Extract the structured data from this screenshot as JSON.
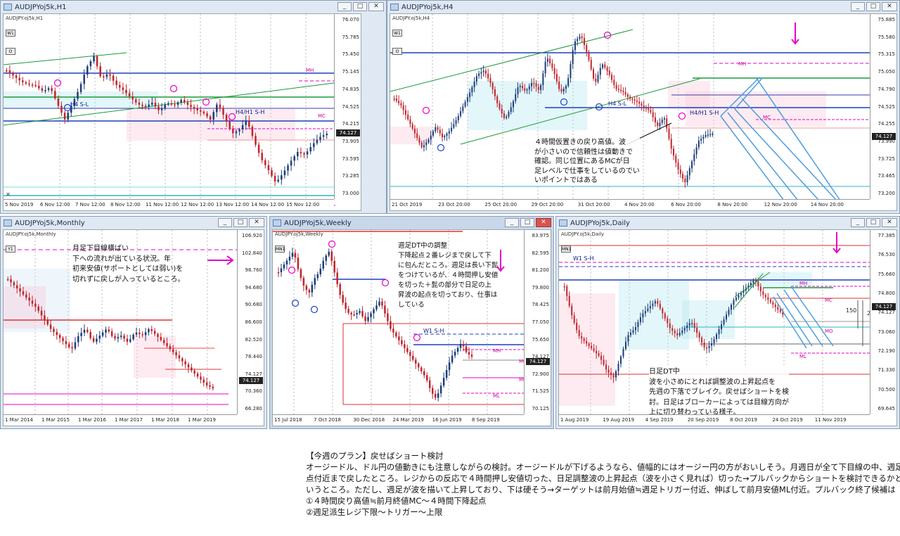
{
  "windows": {
    "h1": {
      "title": "AUDJPYoj5k,H1",
      "symbol": "AUDJPY.oj5k,H1",
      "timeframe": "W1",
      "yticks": [
        "76.070",
        "75.785",
        "75.450",
        "75.145",
        "74.835",
        "74.525",
        "74.215",
        "73.905",
        "73.595",
        "73.285",
        "73.000"
      ],
      "xticks": [
        "5 Nov 2019",
        "6 Nov 12:00",
        "7 Nov 12:00",
        "8 Nov 12:00",
        "11 Nov 12:00",
        "12 Nov 12:00",
        "13 Nov 12:00",
        "14 Nov 12:00",
        "15 Nov 12:00"
      ],
      "price": "74.127",
      "labels": {
        "s_l": "H4 S-L",
        "s_h": "H4/H1 S-H",
        "mh": "MH",
        "mc": "MC",
        "mo": "MO"
      }
    },
    "h4": {
      "title": "AUDJPYoj5k,H4",
      "symbol": "AUDJPY.oj5k,H4",
      "timeframe": "W1",
      "yticks": [
        "75.885",
        "75.580",
        "75.315",
        "75.050",
        "74.790",
        "74.525",
        "74.255",
        "73.990",
        "73.725",
        "73.465",
        "73.200"
      ],
      "xticks": [
        "21 Oct 2019",
        "23 Oct 20:00",
        "25 Oct 20:00",
        "29 Oct 20:00",
        "31 Oct 20:00",
        "4 Nov 20:00",
        "6 Nov 20:00",
        "8 Nov 20:00",
        "12 Nov 20:00",
        "14 Nov 20:00"
      ],
      "price": "74.127",
      "labels": {
        "s_l": "H4 S-L",
        "s_h": "H4/H1 S-H",
        "mh": "MH",
        "mc": "MC"
      },
      "note": "４時間仮置きの戻り高値。波\nが小さいので信頼性は値動きで\n確認。同じ位置にあるMCが日\n足レベルで仕事をしているのでい\nいポイントではある"
    },
    "monthly": {
      "title": "AUDJPYoj5k,Monthly",
      "symbol": "AUDJPY.oj5k,Monthly",
      "timeframe": "Y1",
      "yticks": [
        "106.920",
        "102.840",
        "98.760",
        "94.680",
        "90.680",
        "86.600",
        "82.520",
        "78.440",
        "74.127",
        "70.360",
        "66.280"
      ],
      "xticks": [
        "1 Mar 2014",
        "1 Mar 2015",
        "1 Mar 2016",
        "1 Mar 2017",
        "1 Mar 2018",
        "1 Mar 2019"
      ],
      "price": "74.127",
      "note": "月足下目線横ばい\n下への流れが出ている状況。年\n初来安値(サポートとしては弱い)を\n切れずに戻しが入っているところ。"
    },
    "weekly": {
      "title": "AUDJPYoj5k,Weekly",
      "symbol": "AUDJPY.oj5k,Weekly",
      "timeframe": "MN1",
      "yticks": [
        "83.975",
        "82.595",
        "81.200",
        "79.800",
        "78.425",
        "77.050",
        "75.650",
        "74.127",
        "72.900",
        "71.525",
        "70.125"
      ],
      "xticks": [
        "15 Jul 2018",
        "7 Oct 2018",
        "30 Dec 2018",
        "24 Mar 2019",
        "16 Jun 2019",
        "8 Sep 2019"
      ],
      "price": "74.127",
      "labels": {
        "s_h": "W1 S-H",
        "mh": "MH",
        "mc": "MC",
        "mo": "MO",
        "ml": "ML"
      },
      "note": "週足DT中の調整\n下降起点２番レジまで戻して下\nに包んだところ。週足は長い下髭\nをつけているが、４時間押し安値\nを切った＋髭の部分で日足の上\n昇波の起点を切っており、仕事は\nしている"
    },
    "daily": {
      "title": "AUDJPYoj5k,Daily",
      "symbol": "AUDJPY.oj5k,Daily",
      "timeframe": "MN1",
      "yticks": [
        "77.385",
        "76.530",
        "75.660",
        "74.800",
        "74.127",
        "73.060",
        "72.190",
        "71.330",
        "70.500",
        "69.645"
      ],
      "xticks": [
        "1 Aug 2019",
        "19 Aug 2019",
        "4 Sep 2019",
        "20 Sep 2019",
        "8 Oct 2019",
        "24 Oct 2019",
        "11 Nov 2019"
      ],
      "price": "74.127",
      "labels": {
        "s_h": "W1 S-H",
        "mh": "MH",
        "mc": "MC",
        "mo": "MO",
        "ml": "ML",
        "d150": "150",
        "d250": "250"
      },
      "note": "日足DT中\n波を小さめにとれば調整波の上昇起点を\n先週の下落でブレイク。戻せばショートを検\n討。日足はブローカーによっては目線方向が\n上に切り替わっている様子。"
    }
  },
  "plan": {
    "heading": "【今週のプラン】戻せばショート検討",
    "lines": [
      "オージードル、ドル円の値動きにも注意しながらの検討。オージードルが下げるようなら、値幅的にはオージー円の方がおいしそう。月週日が全て下目線の中、週足下降起",
      "点付近まで戻したところ。レジからの反応で４時間押し安値切った、日足調整波の上昇起点（波を小さく見れば）切った→プルバックからショートを検討できるかと",
      "いうところ。ただし、週足が波を描いて上昇しており、下は硬そう→ターゲットは前月始値≒週足トリガー付近、伸ばして前月安値ML付近。プルバック終了候補は",
      "①４時間戻り高値≒前月終値MC〜４時間下降起点",
      "②週足派生レジ下限〜トリガー〜上限"
    ]
  },
  "colors": {
    "bull": "#1c3d7a",
    "bear": "#c0242b",
    "magenta": "#e800c8",
    "blue": "#1f3fbf",
    "green": "#1a9a3a",
    "cyan": "#2bb6c9",
    "arrow": "#4d9de0"
  }
}
